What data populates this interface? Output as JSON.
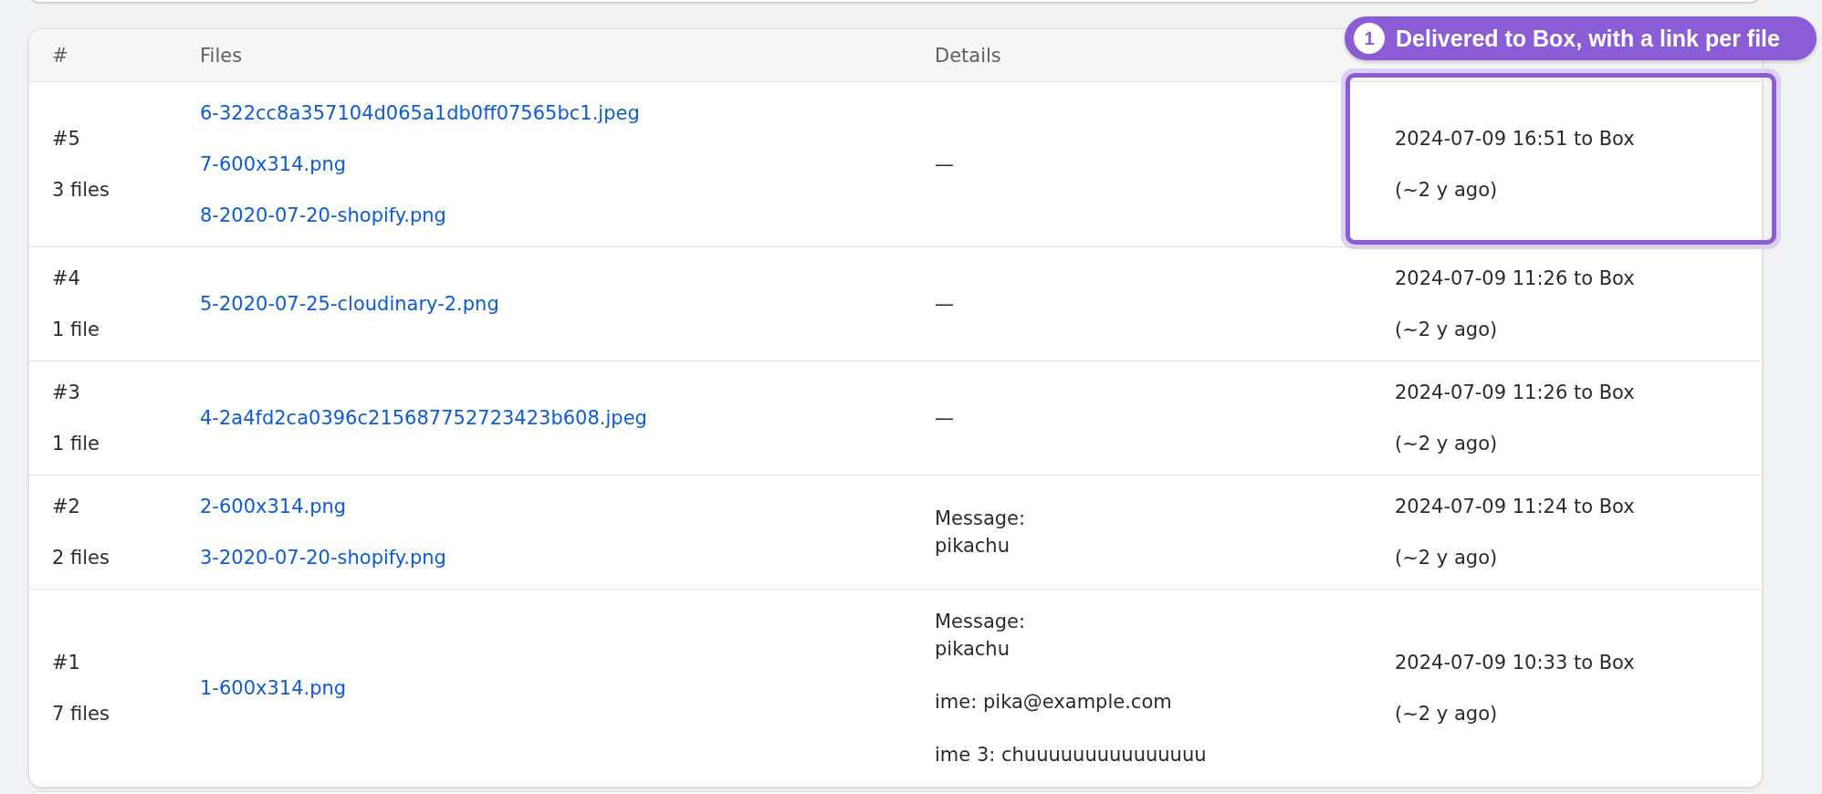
{
  "table": {
    "columns": [
      "#",
      "Files",
      "Details"
    ],
    "rows": [
      {
        "number": "#5",
        "file_count": "3 files",
        "files": [
          "6-322cc8a357104d065a1db0ff07565bc1.jpeg",
          "7-600x314.png",
          "8-2020-07-20-shopify.png"
        ],
        "details": [
          "—"
        ],
        "delivered": "2024-07-09 16:51 to Box",
        "age": "(~2 y ago)",
        "highlighted": true
      },
      {
        "number": "#4",
        "file_count": "1 file",
        "files": [
          "5-2020-07-25-cloudinary-2.png"
        ],
        "details": [
          "—"
        ],
        "delivered": "2024-07-09 11:26 to Box",
        "age": "(~2 y ago)",
        "highlighted": false
      },
      {
        "number": "#3",
        "file_count": "1 file",
        "files": [
          "4-2a4fd2ca0396c215687752723423b608.jpeg"
        ],
        "details": [
          "—"
        ],
        "delivered": "2024-07-09 11:26 to Box",
        "age": "(~2 y ago)",
        "highlighted": false
      },
      {
        "number": "#2",
        "file_count": "2 files",
        "files": [
          "2-600x314.png",
          "3-2020-07-20-shopify.png"
        ],
        "details": [
          "Message:\npikachu"
        ],
        "delivered": "2024-07-09 11:24 to Box",
        "age": "(~2 y ago)",
        "highlighted": false
      },
      {
        "number": "#1",
        "file_count": "7 files",
        "files": [
          "1-600x314.png"
        ],
        "details": [
          "Message:\npikachu",
          "ime: pika@example.com",
          "ime 3: chuuuuuuuuuuuuuuu"
        ],
        "delivered": "2024-07-09 10:33 to Box",
        "age": "(~2 y ago)",
        "highlighted": false
      }
    ]
  },
  "callout": {
    "number": "1",
    "text": "Delivered to Box, with a link per file"
  }
}
